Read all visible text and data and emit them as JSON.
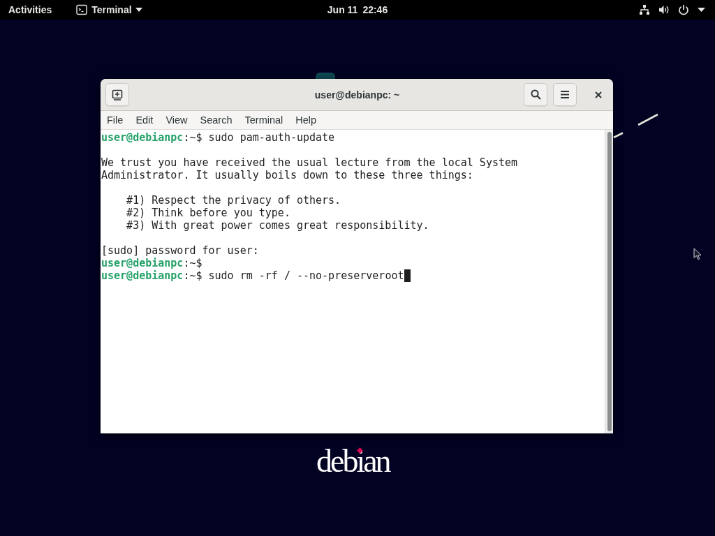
{
  "top_bar": {
    "activities": "Activities",
    "app_menu": "Terminal",
    "clock": "Jun 11 22:46"
  },
  "window": {
    "title": "user@debianpc: ~",
    "menu": [
      "File",
      "Edit",
      "View",
      "Search",
      "Terminal",
      "Help"
    ],
    "terminal_lines": [
      {
        "kind": "prompt",
        "user_host": "user@debianpc",
        "prompt": ":~$",
        "command": "sudo pam-auth-update",
        "cursor": false
      },
      {
        "kind": "blank"
      },
      {
        "kind": "output",
        "text": "We trust you have received the usual lecture from the local System"
      },
      {
        "kind": "output",
        "text": "Administrator. It usually boils down to these three things:"
      },
      {
        "kind": "blank"
      },
      {
        "kind": "indented",
        "text": "#1) Respect the privacy of others."
      },
      {
        "kind": "indented",
        "text": "#2) Think before you type."
      },
      {
        "kind": "indented",
        "text": "#3) With great power comes great responsibility."
      },
      {
        "kind": "blank"
      },
      {
        "kind": "output",
        "text": "[sudo] password for user:"
      },
      {
        "kind": "prompt",
        "user_host": "user@debianpc",
        "prompt": ":~$",
        "cursor": false
      },
      {
        "kind": "prompt",
        "user_host": "user@debianpc",
        "prompt": ":~$",
        "command": "sudo rm -rf / --no-preserveroot",
        "cursor": true
      }
    ]
  },
  "desktop": {
    "logo": "debian"
  }
}
